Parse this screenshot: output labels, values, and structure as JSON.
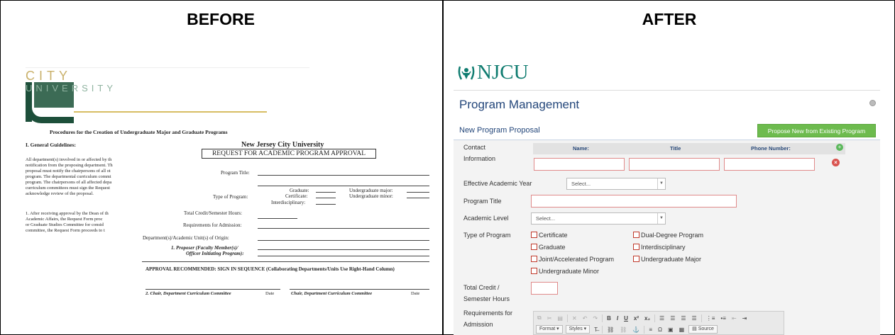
{
  "panels": {
    "before_label": "BEFORE",
    "after_label": "AFTER"
  },
  "before_doc": {
    "logo_city": "CITY",
    "logo_university": "UNIVERSITY",
    "title": "Procedures for the Creation of Undergraduate Major and Graduate Programs",
    "section_heading": "I. General Guidelines:",
    "paragraph_lines": [
      "All department(s) involved in or affected by th",
      "notification from the proposing department. Th",
      "proposal must notify the chairpersons of all ot",
      "program. The departmental curriculum commi",
      "program. The chairpersons of all affected depa",
      "curriculum committees must sign the Request",
      "acknowledge review of the proposal."
    ],
    "item1_lines": [
      "1.   After receiving approval by the Dean of th",
      "      Academic Affairs, the Request Form proc",
      "      or Graduate Studies Committee for consid",
      "      committee, the Request Form proceeds to t"
    ],
    "form_university": "New Jersey City University",
    "form_request": "REQUEST FOR ACADEMIC PROGRAM APPROVAL",
    "program_title_label": "Program Title:",
    "type_of_program_label": "Type of Program:",
    "graduate_label": "Graduate:",
    "certificate_label": "Certificate:",
    "interdisciplinary_label": "Interdisciplinary:",
    "undergrad_major_label": "Undergraduate major:",
    "undergrad_minor_label": "Undergraduate minor:",
    "total_credit_label": "Total Credit/Semester Hours:",
    "requirements_label": "Requirements for Admission:",
    "departments_label": "Department(s)/Academic Unit(s) of Origin:",
    "proposer_label_1": "1.  Proposer (Faculty Member(s)/",
    "proposer_label_2": "Officer Initiating Program):",
    "approval_text": "APPROVAL RECOMMENDED: SIGN IN SEQUENCE (Collaborating Departments/Units Use Right-Hand Column)",
    "chair_left": "2. Chair, Department Curriculum Committee",
    "date_left": "Date",
    "chair_right": "Chair, Department Curriculum Committee",
    "date_right": "Date"
  },
  "after_ui": {
    "logo_text": "NJCU",
    "page_title": "Program Management",
    "section_title": "New Program Proposal",
    "propose_button": "Propose New from Existing Program",
    "contact_label_1": "Contact",
    "contact_label_2": "Information",
    "col_name": "Name:",
    "col_title": "Title",
    "col_phone": "Phone Number:",
    "effective_year_label": "Effective Academic Year",
    "effective_year_value": "Select...",
    "program_title_label": "Program Title",
    "academic_level_label": "Academic Level",
    "academic_level_value": "Select...",
    "type_of_program_label": "Type of Program",
    "checkboxes": {
      "certificate": "Certificate",
      "dual_degree": "Dual-Degree Program",
      "graduate": "Graduate",
      "interdisciplinary": "Interdisciplinary",
      "joint": "Joint/Accelerated Program",
      "undergrad_major": "Undergraduate Major",
      "undergrad_minor": "Undergraduate Minor"
    },
    "total_credit_label_1": "Total Credit /",
    "total_credit_label_2": "Semester Hours",
    "requirements_label_1": "Requirements for",
    "requirements_label_2": "Admission",
    "toolbar": {
      "bold": "B",
      "italic": "I",
      "underline": "U",
      "superscript": "x²",
      "subscript": "x₂",
      "format_dropdown": "Format",
      "styles_dropdown": "Styles",
      "source_button": "Source"
    }
  }
}
